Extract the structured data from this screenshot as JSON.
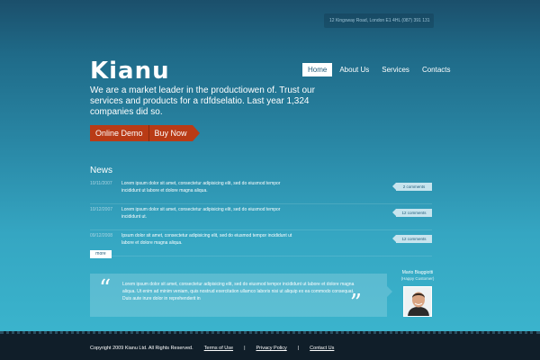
{
  "header": {
    "address": "12 Kingsway Road, London E1 4HL      (087) 391 131",
    "logo": "Kianu",
    "nav": [
      {
        "label": "Home",
        "active": true
      },
      {
        "label": "About Us",
        "active": false
      },
      {
        "label": "Services",
        "active": false
      },
      {
        "label": "Contacts",
        "active": false
      }
    ]
  },
  "hero": {
    "tagline": "We are a market leader in the productiowen of. Trust our services and products for a rdfdselatio. Last year 1,324 companies did so.",
    "cta_demo": "Online Demo",
    "cta_buy": "Buy Now"
  },
  "news": {
    "title": "News",
    "items": [
      {
        "date": "10/11/2007",
        "text": "Lorem ipsum dolor sit amet, consectetur adipisicing elit, sed do eiusmod tempor incididunt ut labore et dolore magna aliqua.",
        "comments": "2 comments"
      },
      {
        "date": "10/12/2007",
        "text": "Lorem ipsum dolor sit amet, consectetur adipisicing elit, sed do eiusmod tempor incididunt ut.",
        "comments": "12 comments"
      },
      {
        "date": "09/12/2008",
        "text": "Ipsum dolor sit amet, consectetur adipisicing elit, sed do eiusmod tempor incididunt ut labore et dolore magna aliqua.",
        "comments": "12 comments"
      }
    ],
    "more": "more"
  },
  "testimonial": {
    "text": "Lorem ipsum dolor sit amet, consectetur adipisicing elit, sed do eiusmod tempor incididunt ut labore et dolore magna aliqua. Ut enim ad minim veniam, quis nostrud exercitation ullamco laboris nisi ut aliquip ex ea commodo consequat. Duis aute irure dolor in reprehenderit in",
    "open_quote": "“",
    "close_quote": "”",
    "person_name": "Mario Biaggiotti",
    "person_role": "(Happy Customer)"
  },
  "footer": {
    "copyright": "Copyright 2009    Kianu Ltd. All Rights Reserved.",
    "links": [
      "Terms of Use",
      "Privacy Policy",
      "Contact Us"
    ],
    "separator": "|"
  },
  "colors": {
    "accent": "#b93b16",
    "background_top": "#1b4f6b",
    "background_bottom": "#3ab3cc",
    "footer": "#101e29"
  }
}
